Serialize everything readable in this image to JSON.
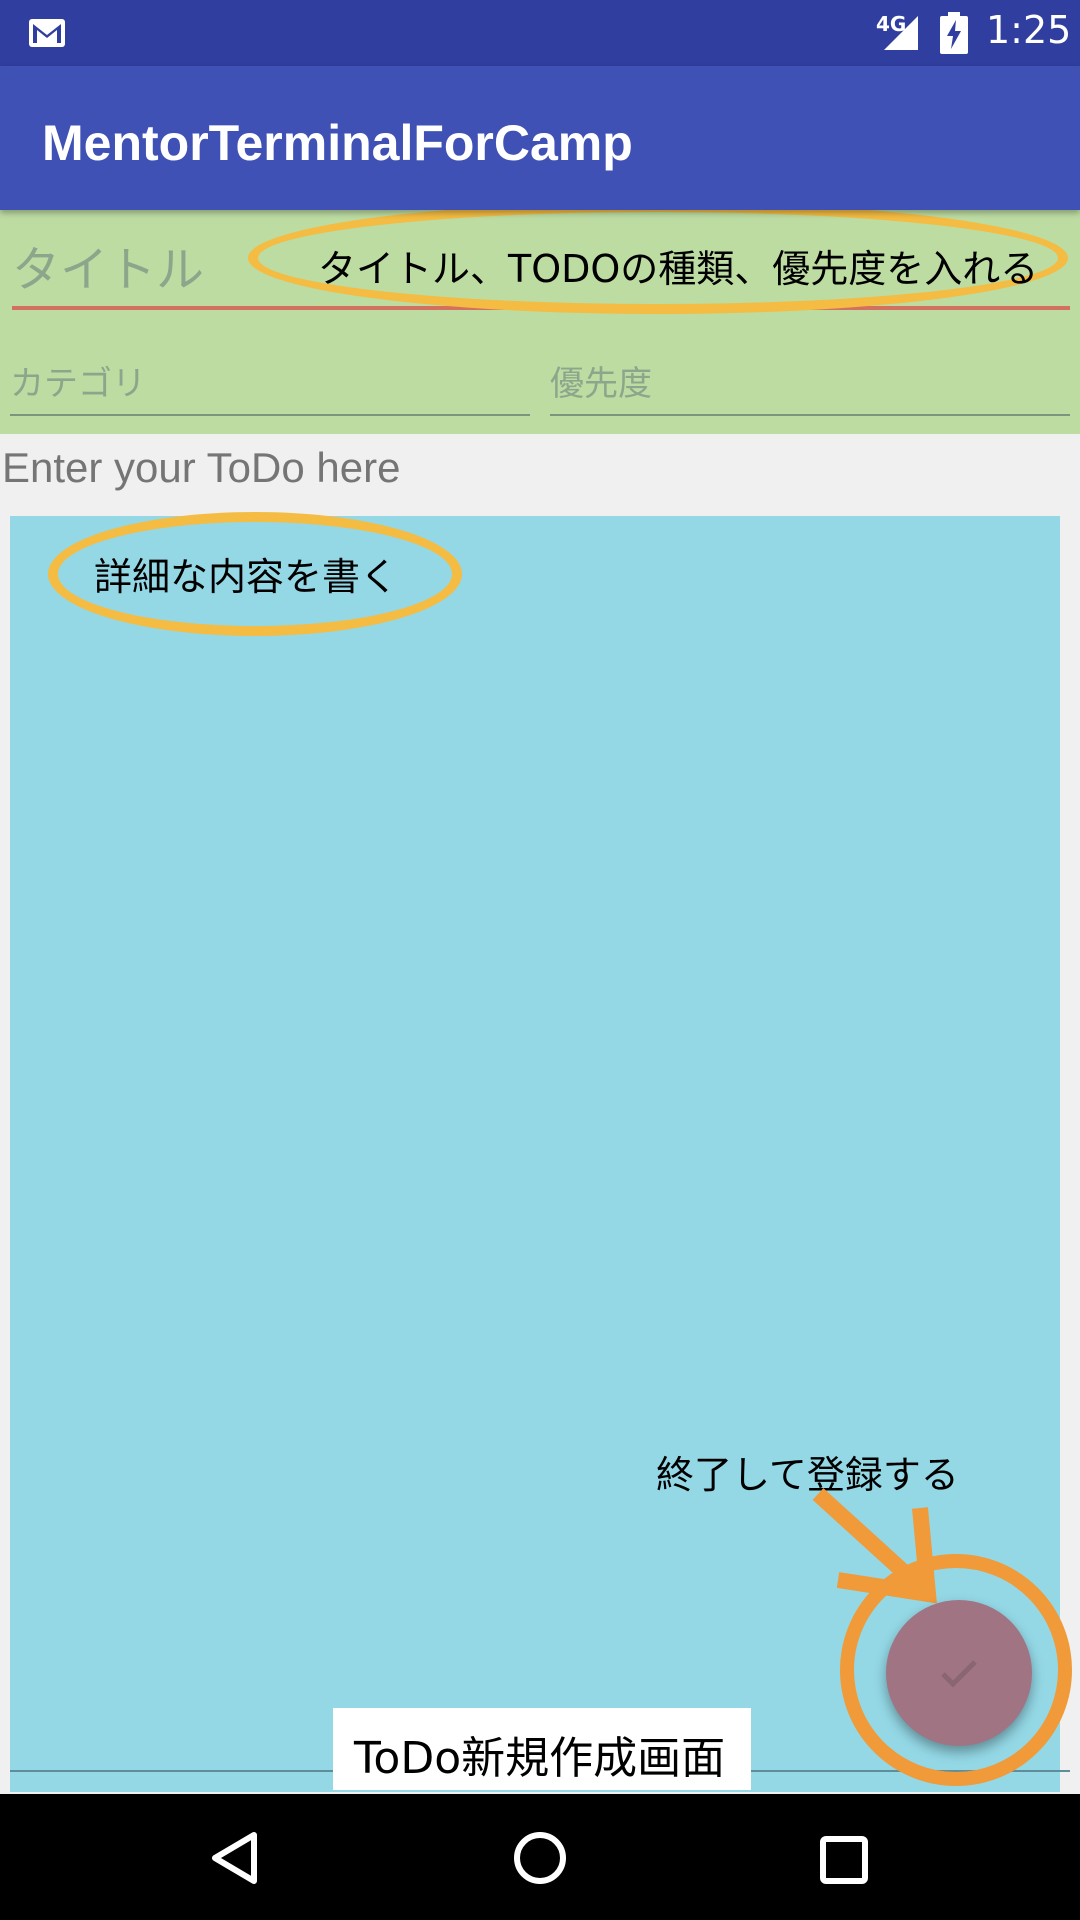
{
  "status_bar": {
    "mail_icon": "gmail-icon",
    "network": "4G",
    "signal_icon": "signal-icon",
    "battery_icon": "battery-charging-icon",
    "time": "1:25"
  },
  "app_bar": {
    "title": "MentorTerminalForCamp"
  },
  "form": {
    "title_placeholder": "タイトル",
    "category_placeholder": "カテゴリ",
    "priority_placeholder": "優先度",
    "todo_label": "Enter your ToDo here",
    "todo_body_value": ""
  },
  "fab": {
    "icon": "check-icon"
  },
  "annotations": {
    "top_note": "タイトル、TODOの種類、優先度を入れる",
    "detail_note": "詳細な内容を書く",
    "finish_note": "終了して登録する",
    "caption": "ToDo新規作成画面"
  },
  "nav_bar": {
    "back_icon": "back-triangle-icon",
    "home_icon": "home-circle-icon",
    "recents_icon": "recents-square-icon"
  },
  "colors": {
    "status_bar": "#303f9f",
    "app_bar": "#3f51b5",
    "header_bg": "#bddca2",
    "todo_bg": "#94d8e6",
    "fab": "#a07482",
    "annotation_yellow": "#f4bc42",
    "annotation_orange": "#f09a3a"
  }
}
